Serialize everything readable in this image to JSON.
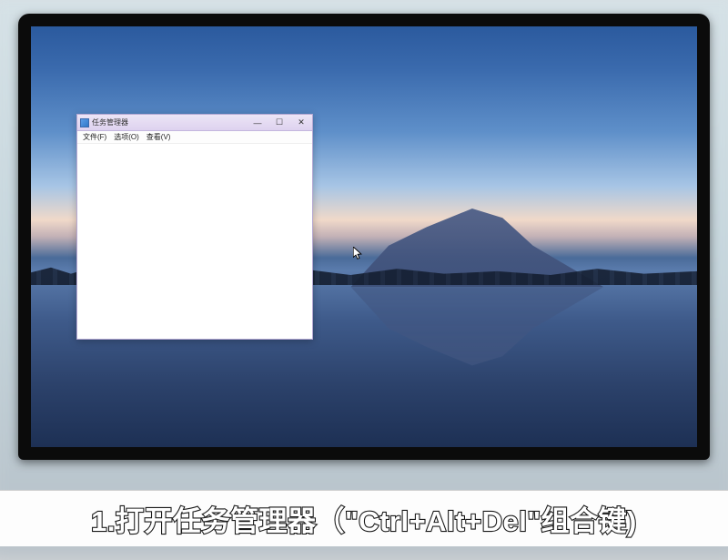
{
  "window": {
    "title": "任务管理器",
    "menu": {
      "file": "文件(F)",
      "options": "选项(O)",
      "view": "查看(V)"
    },
    "controls": {
      "minimize": "—",
      "maximize": "☐",
      "close": "✕"
    }
  },
  "caption": {
    "text": "1.打开任务管理器（\"Ctrl+Alt+Del\"组合键)"
  }
}
